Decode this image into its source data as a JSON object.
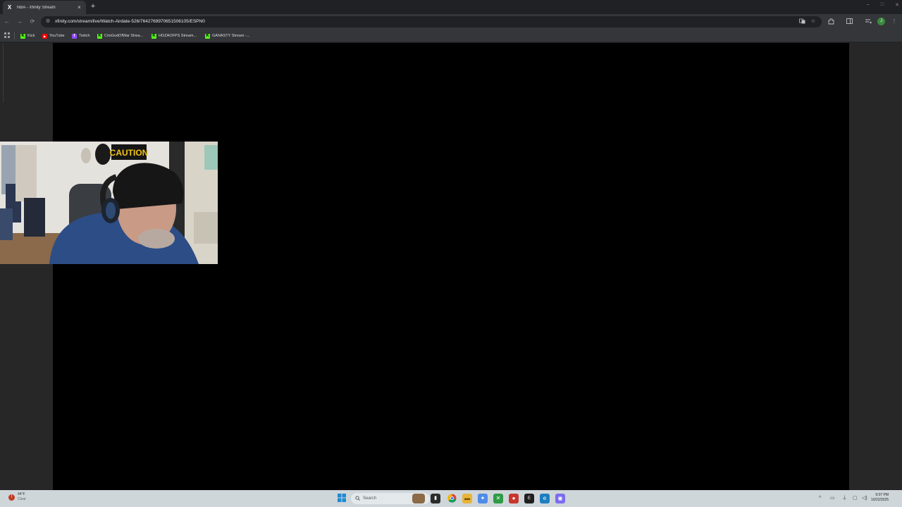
{
  "tab": {
    "favicon": "X",
    "title": "NBA - Xfinity Stream",
    "close": "×"
  },
  "new_tab": "+",
  "window_controls": [
    "–",
    "□",
    "✕"
  ],
  "toolbar": {
    "back": "←",
    "forward": "→",
    "reload": "⟳",
    "site_info": "⚙",
    "url": "xfinity.com/stream/live/Watch-Airdate-526/7642769970651506105/ESPN0"
  },
  "bookmarks": [
    {
      "label": "Kick",
      "icon": "K",
      "color": "#53fc18"
    },
    {
      "label": "YouTube",
      "icon": "▶",
      "color": "#ff0000"
    },
    {
      "label": "Twitch",
      "icon": "t",
      "color": "#9146ff"
    },
    {
      "label": "CrisGodOfWar Strea...",
      "icon": "K",
      "color": "#53fc18"
    },
    {
      "label": "HOZAOFPS Stream...",
      "icon": "K",
      "color": "#53fc18"
    },
    {
      "label": "GANASTY Stream -...",
      "icon": "K",
      "color": "#53fc18"
    }
  ],
  "profile_initial": "J",
  "webcam": {
    "sign_text": "CAUTION"
  },
  "taskbar": {
    "weather_temp": "44°F",
    "weather_desc": "Clear",
    "search_placeholder": "Search",
    "time": "9:07 PM",
    "date": "10/22/2025"
  }
}
